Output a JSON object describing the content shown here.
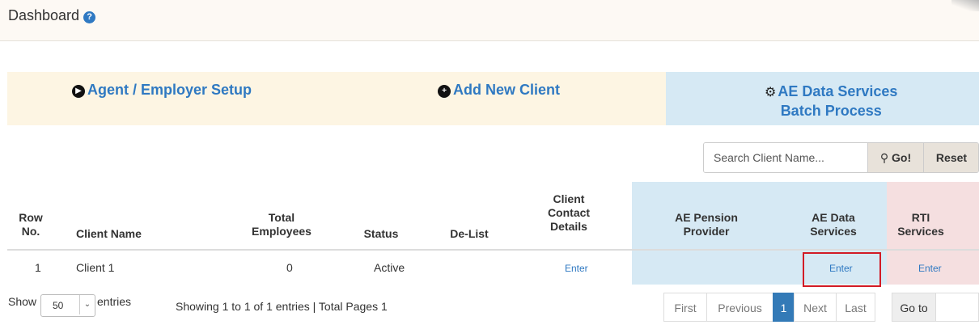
{
  "header": {
    "title": "Dashboard",
    "help_icon": "question-circle-icon"
  },
  "actions": {
    "setup_label": "Agent / Employer Setup",
    "add_client_label": "Add New Client",
    "ae_line1": "AE Data Services",
    "ae_line2": "Batch Process"
  },
  "search": {
    "placeholder": "Search Client Name...",
    "go_label": "Go!",
    "reset_label": "Reset"
  },
  "table": {
    "headers": {
      "row_no": [
        "Row",
        "No."
      ],
      "client_name": "Client Name",
      "total_employees": [
        "Total",
        "Employees"
      ],
      "status": "Status",
      "delist": "De-List",
      "contact": [
        "Client",
        "Contact",
        "Details"
      ],
      "ae_pension": [
        "AE Pension",
        "Provider"
      ],
      "ae_data": [
        "AE Data",
        "Services"
      ],
      "rti": [
        "RTI",
        "Services"
      ]
    },
    "rows": [
      {
        "row_no": "1",
        "client_name": "Client 1",
        "total_employees": "0",
        "status": "Active",
        "contact": "Enter",
        "ae_data": "Enter",
        "rti": "Enter"
      }
    ]
  },
  "length_menu": {
    "show_label": "Show",
    "value": "50",
    "entries_label": "entries"
  },
  "info": "Showing 1 to 1 of 1 entries | Total Pages 1",
  "pagination": {
    "first": "First",
    "previous": "Previous",
    "current": "1",
    "next": "Next",
    "last": "Last",
    "goto": "Go to"
  },
  "colors": {
    "link": "#2f79c2",
    "cream": "#fdf5e3",
    "blue_panel": "#d6e9f4",
    "pink_panel": "#f5dfe0",
    "highlight": "#d21b25"
  }
}
